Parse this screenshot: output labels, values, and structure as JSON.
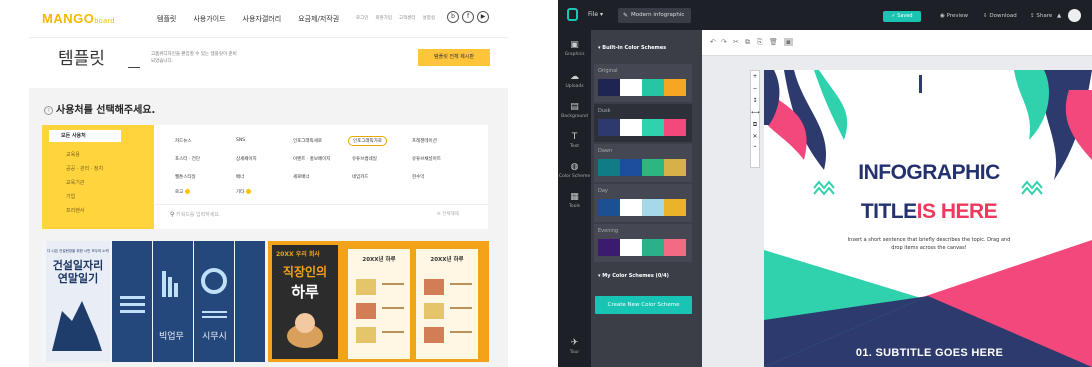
{
  "left": {
    "logo": {
      "main": "MANGO",
      "sub": "board"
    },
    "nav": [
      "템플릿",
      "사용가이드",
      "사용자갤러리",
      "요금제/저작권"
    ],
    "nav_small": [
      "로그인",
      "회원가입",
      "고객센터",
      "설정실"
    ],
    "social": [
      "b",
      "f",
      "▶"
    ],
    "hero": {
      "title": "템플릿",
      "desc": "고품위디자인을 편집할 수 있는 템플릿이 준비 되었습니다.",
      "button": "템플릿 전체 제시판"
    },
    "select_title": "사용처를 선택해주세요.",
    "categories_left": {
      "active": "모든 사용처",
      "items": [
        "교육용",
        "공공 · 관리 · 정치",
        "교육기관",
        "기업",
        "프리랜서"
      ]
    },
    "categories": [
      [
        "카드뉴스",
        "SNS",
        "인포그래픽세로",
        "인포그래픽가로",
        "프레젠테이션"
      ],
      [
        "포스터 · 전단",
        "상세페이지",
        "이벤트 · 홍보페이지",
        "유튜브썸네일",
        "유튜브채널아트"
      ],
      [
        "웹툰스타일",
        "배너",
        "세로배너",
        "네임카드",
        "현수막"
      ],
      [
        "로고",
        "기타"
      ]
    ],
    "search_placeholder": "키워드를 입력하세요.",
    "search_right": "전체해제",
    "thumb1": {
      "title": "건설일자리 연말일기",
      "subtitle": "다 나은 건설현장을 위한 시민 모두의 노력",
      "label1": "빅업무",
      "label2": "시무시"
    },
    "thumb2": {
      "banner": "20XX 우리 회사",
      "big1": "직장인의",
      "big2": "하루",
      "card": "20XX년 하루",
      "card2": "20XX년 하루"
    }
  },
  "right": {
    "topbar": {
      "file": "File",
      "tab": "Modern infographic",
      "saved": "Saved",
      "preview": "Preview",
      "download": "Download",
      "share": "Share"
    },
    "rail": [
      {
        "icon": "▣",
        "label": "Graphics"
      },
      {
        "icon": "☁",
        "label": "Uploads"
      },
      {
        "icon": "▤",
        "label": "Background"
      },
      {
        "icon": "T",
        "label": "Text"
      },
      {
        "icon": "◍",
        "label": "Color Scheme"
      },
      {
        "icon": "▦",
        "label": "Tools"
      },
      {
        "icon": "✈",
        "label": "Tour"
      }
    ],
    "panel": {
      "builtin_title": "Built-in Color Schemes",
      "schemes": [
        {
          "name": "Original",
          "colors": [
            "#1f2552",
            "#ffffff",
            "#26c6a4",
            "#f6a623"
          ]
        },
        {
          "name": "Dusk",
          "colors": [
            "#2d3a6e",
            "#ffffff",
            "#2fd2ad",
            "#f2487b"
          ]
        },
        {
          "name": "Dawn",
          "colors": [
            "#127c86",
            "#1d4e9e",
            "#2db682",
            "#d6b14a"
          ]
        },
        {
          "name": "Day",
          "colors": [
            "#1d4f93",
            "#ffffff",
            "#a5d9ea",
            "#e9b42a"
          ]
        },
        {
          "name": "Evening",
          "colors": [
            "#3c1a70",
            "#ffffff",
            "#2bb08a",
            "#f26a84"
          ]
        }
      ],
      "my_title": "My Color Schemes (0/4)",
      "new_button": "Create New Color Scheme"
    },
    "toolbar": [
      "↶",
      "↷",
      "✂",
      "⧉",
      "⎘",
      "🗑",
      "▪"
    ],
    "vtools": [
      "+",
      "−",
      "↕",
      "⟷",
      "⧉",
      "✕",
      "⌃"
    ],
    "infographic": {
      "title1": "INFOGRAPHIC",
      "title2a": "TITLE",
      "title2b": "IS HERE",
      "desc": "Insert a short sentence that briefly describes the topic. Drag and drop items across the canvas!",
      "subtitle": "01. SUBTITLE GOES HERE"
    }
  }
}
